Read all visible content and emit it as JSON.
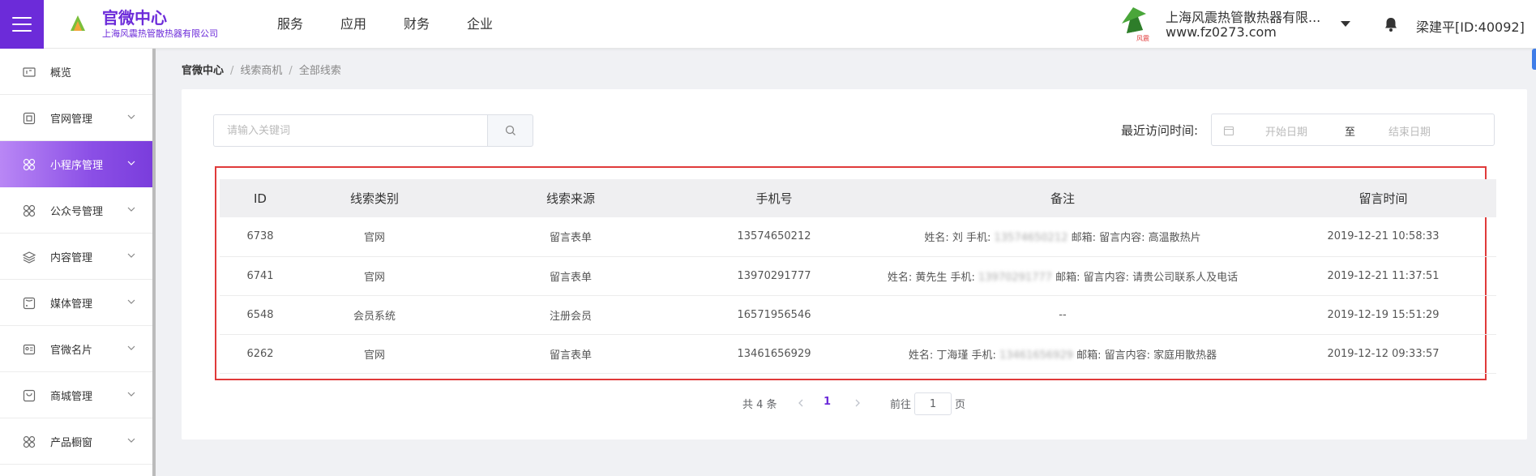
{
  "header": {
    "brand_title": "官微中心",
    "brand_subtitle": "上海风震热管散热器有限公司",
    "nav": [
      "服务",
      "应用",
      "财务",
      "企业"
    ],
    "company_name": "上海风震热管散热器有限...",
    "company_url": "www.fz0273.com",
    "company_logo_text": "风震",
    "user": "梁建平[ID:40092]"
  },
  "sidebar": {
    "items": [
      {
        "label": "概览",
        "icon": "overview-icon",
        "chevron": false,
        "active": false
      },
      {
        "label": "官网管理",
        "icon": "website-icon",
        "chevron": true,
        "active": false
      },
      {
        "label": "小程序管理",
        "icon": "miniapp-icon",
        "chevron": true,
        "active": true
      },
      {
        "label": "公众号管理",
        "icon": "official-account-icon",
        "chevron": true,
        "active": false
      },
      {
        "label": "内容管理",
        "icon": "content-icon",
        "chevron": true,
        "active": false
      },
      {
        "label": "媒体管理",
        "icon": "media-icon",
        "chevron": true,
        "active": false
      },
      {
        "label": "官微名片",
        "icon": "card-icon",
        "chevron": true,
        "active": false
      },
      {
        "label": "商城管理",
        "icon": "shop-icon",
        "chevron": true,
        "active": false
      },
      {
        "label": "产品橱窗",
        "icon": "product-icon",
        "chevron": true,
        "active": false
      }
    ]
  },
  "breadcrumb": {
    "root": "官微中心",
    "sep": "/",
    "level2": "线索商机",
    "level3": "全部线索"
  },
  "filters": {
    "search_placeholder": "请输入关键词",
    "date_label": "最近访问时间:",
    "date_start_placeholder": "开始日期",
    "date_sep": "至",
    "date_end_placeholder": "结束日期"
  },
  "table": {
    "headers": [
      "ID",
      "线索类别",
      "线索来源",
      "手机号",
      "备注",
      "留言时间"
    ],
    "rows": [
      {
        "id": "6738",
        "category": "官网",
        "source": "留言表单",
        "phone": "13574650212",
        "note_pre": "姓名: 刘 手机:",
        "note_blur": "13574650212",
        "note_post": "邮箱: 留言内容: 高温散热片",
        "time": "2019-12-21 10:58:33"
      },
      {
        "id": "6741",
        "category": "官网",
        "source": "留言表单",
        "phone": "13970291777",
        "note_pre": "姓名: 黄先生 手机:",
        "note_blur": "13970291777",
        "note_post": "邮箱: 留言内容: 请贵公司联系人及电话",
        "time": "2019-12-21 11:37:51"
      },
      {
        "id": "6548",
        "category": "会员系统",
        "source": "注册会员",
        "phone": "16571956546",
        "note_pre": "--",
        "note_blur": "",
        "note_post": "",
        "time": "2019-12-19 15:51:29"
      },
      {
        "id": "6262",
        "category": "官网",
        "source": "留言表单",
        "phone": "13461656929",
        "note_pre": "姓名: 丁海瑾 手机:",
        "note_blur": "13461656929",
        "note_post": "邮箱: 留言内容: 家庭用散热器",
        "time": "2019-12-12 09:33:57"
      }
    ]
  },
  "pagination": {
    "total": "共 4 条",
    "current": "1",
    "goto_label": "前往",
    "goto_value": "1",
    "page_suffix": "页"
  },
  "colors": {
    "brand": "#6c2bd9",
    "highlight_border": "#e03a3a"
  }
}
